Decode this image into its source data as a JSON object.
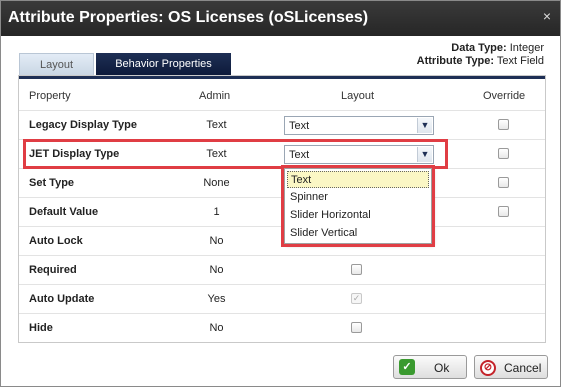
{
  "window": {
    "title": "Attribute Properties: OS Licenses (oSLicenses)",
    "close_label": "×"
  },
  "meta": {
    "data_type_label": "Data Type:",
    "data_type_value": "Integer",
    "attribute_type_label": "Attribute Type:",
    "attribute_type_value": "Text Field"
  },
  "tabs": [
    {
      "label": "Layout",
      "active": false
    },
    {
      "label": "Behavior Properties",
      "active": true
    }
  ],
  "table": {
    "headers": [
      "Property",
      "Admin",
      "Layout",
      "Override"
    ],
    "rows": [
      {
        "property": "Legacy Display Type",
        "admin": "Text",
        "layout_select": "Text",
        "override": "unchecked"
      },
      {
        "property": "JET Display Type",
        "admin": "Text",
        "layout_select": "Text",
        "override": "unchecked"
      },
      {
        "property": "Set Type",
        "admin": "None",
        "override": "unchecked"
      },
      {
        "property": "Default Value",
        "admin": "1",
        "override": "unchecked"
      },
      {
        "property": "Auto Lock",
        "admin": "No"
      },
      {
        "property": "Required",
        "admin": "No",
        "layout_checkbox": "unchecked"
      },
      {
        "property": "Auto Update",
        "admin": "Yes",
        "layout_checkbox": "checked-disabled"
      },
      {
        "property": "Hide",
        "admin": "No",
        "layout_checkbox": "unchecked"
      }
    ]
  },
  "dropdown": {
    "options": [
      "Text",
      "Spinner",
      "Slider Horizontal",
      "Slider Vertical"
    ],
    "selected": "Text"
  },
  "buttons": {
    "ok": "Ok",
    "cancel": "Cancel"
  },
  "colors": {
    "titlebar": "#2e2e2e",
    "active_tab": "#1e2f55",
    "highlight": "#e03d44",
    "selected_option": "#fbf7c5"
  }
}
